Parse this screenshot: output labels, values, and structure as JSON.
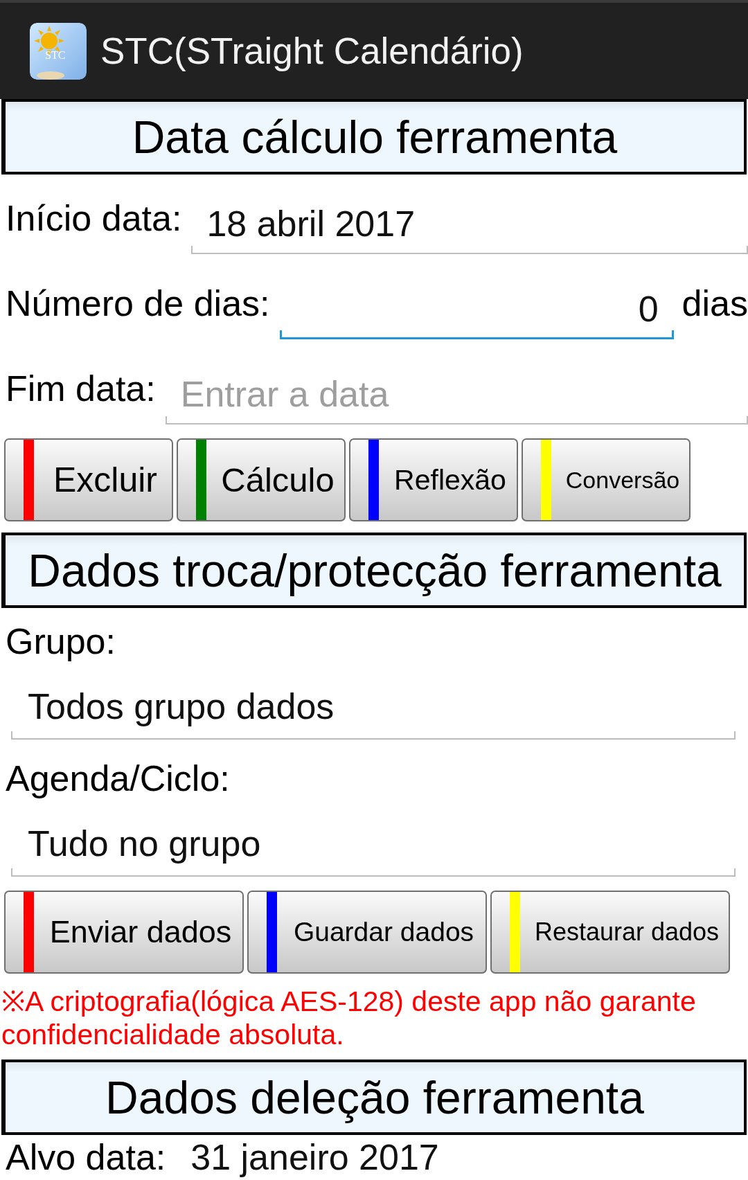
{
  "app_bar": {
    "title": "STC(STraight Calendário)",
    "icon_text": "STC"
  },
  "sections": [
    {
      "title": "Data cálculo ferramenta",
      "fields": [
        {
          "kind": "inline",
          "label": "Início data:",
          "value": "18 abril 2017",
          "focused": false
        },
        {
          "kind": "inline",
          "label": "Número de dias:",
          "value": "0",
          "suffix": "dias",
          "focused": true
        },
        {
          "kind": "inline",
          "label": "Fim data:",
          "placeholder": "Entrar a data",
          "focused": false
        }
      ],
      "buttons": [
        {
          "label": "Excluir",
          "color": "#ff0000"
        },
        {
          "label": "Cálculo",
          "color": "#008000"
        },
        {
          "label": "Reflexão",
          "color": "#0000ff"
        },
        {
          "label": "Conversão",
          "color": "#ffff00"
        }
      ]
    },
    {
      "title": "Dados troca/protecção ferramenta",
      "fields": [
        {
          "kind": "stacked",
          "label": "Grupo:",
          "value": "Todos grupo dados",
          "focused": false
        },
        {
          "kind": "stacked",
          "label": "Agenda/Ciclo:",
          "value": "Tudo no grupo",
          "focused": false
        }
      ],
      "buttons": [
        {
          "label": "Enviar dados",
          "color": "#ff0000"
        },
        {
          "label": "Guardar dados",
          "color": "#0000ff"
        },
        {
          "label": "Restaurar dados",
          "color": "#ffff00"
        }
      ],
      "note": "※A criptografia(lógica AES-128) deste app não garante confidencialidade absoluta."
    },
    {
      "title": "Dados deleção ferramenta",
      "fields": [
        {
          "kind": "inline",
          "label": "Alvo data:",
          "value": "31 janeiro 2017"
        }
      ]
    }
  ]
}
